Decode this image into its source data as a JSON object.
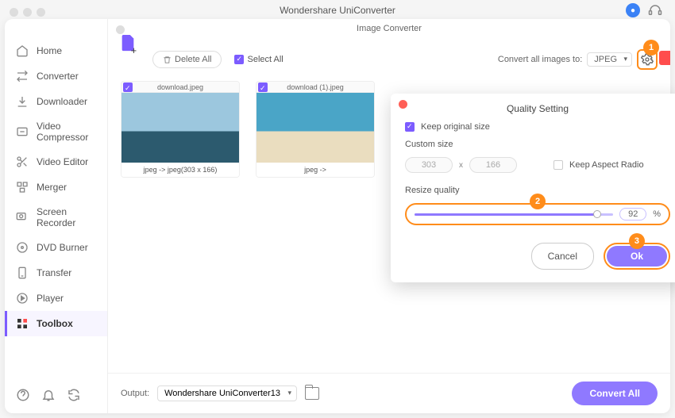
{
  "app_title": "Wondershare UniConverter",
  "panel_title": "Image Converter",
  "sidebar": {
    "items": [
      {
        "label": "Home"
      },
      {
        "label": "Converter"
      },
      {
        "label": "Downloader"
      },
      {
        "label": "Video Compressor"
      },
      {
        "label": "Video Editor"
      },
      {
        "label": "Merger"
      },
      {
        "label": "Screen Recorder"
      },
      {
        "label": "DVD Burner"
      },
      {
        "label": "Transfer"
      },
      {
        "label": "Player"
      },
      {
        "label": "Toolbox"
      }
    ]
  },
  "toolbar": {
    "delete_all": "Delete All",
    "select_all": "Select All",
    "convert_label": "Convert all images to:",
    "format": "JPEG"
  },
  "thumbs": [
    {
      "name": "download.jpeg",
      "caption": "jpeg -> jpeg(303 x 166)"
    },
    {
      "name": "download (1).jpeg",
      "caption": "jpeg ->"
    }
  ],
  "modal": {
    "title": "Quality Setting",
    "keep_original": "Keep original size",
    "custom_size": "Custom size",
    "w": "303",
    "h": "166",
    "aspect": "Keep Aspect Radio",
    "resize_q": "Resize quality",
    "quality": "92",
    "pct": "%",
    "cancel": "Cancel",
    "ok": "Ok"
  },
  "callouts": {
    "c1": "1",
    "c2": "2",
    "c3": "3"
  },
  "footer": {
    "output_label": "Output:",
    "output_path": "Wondershare UniConverter13",
    "convert_all": "Convert All"
  }
}
